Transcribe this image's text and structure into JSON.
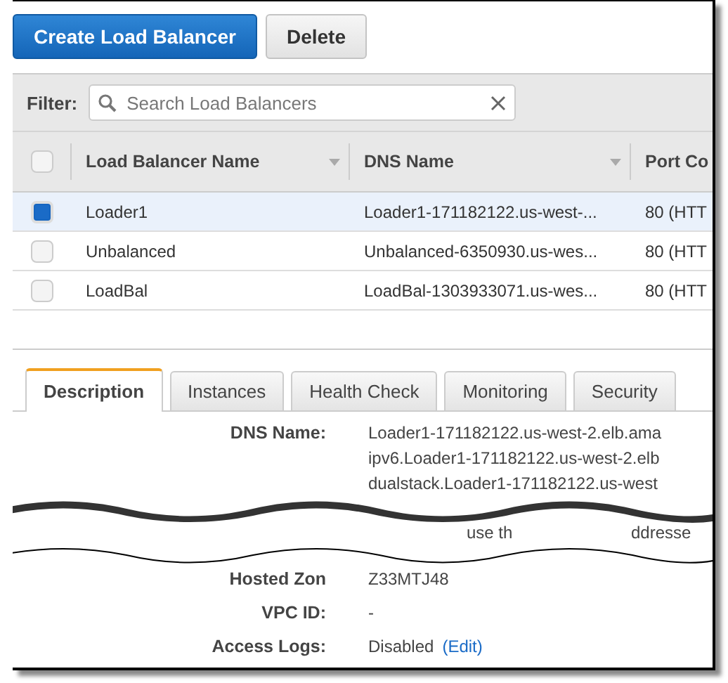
{
  "toolbar": {
    "buttons": [
      {
        "label": "Create Load Balancer",
        "kind": "primary"
      },
      {
        "label": "Delete",
        "kind": "secondary"
      }
    ]
  },
  "filter": {
    "label": "Filter:",
    "placeholder": "Search Load Balancers"
  },
  "table": {
    "select_all": {
      "checked": false
    },
    "columns": [
      "Load Balancer Name",
      "DNS Name",
      "Port Co"
    ],
    "rows": [
      {
        "selected": true,
        "cells": [
          "Loader1",
          "Loader1-171182122.us-west-...",
          "80 (HTT"
        ]
      },
      {
        "selected": false,
        "cells": [
          "Unbalanced",
          "Unbalanced-6350930.us-wes...",
          "80 (HTT"
        ]
      },
      {
        "selected": false,
        "cells": [
          "LoadBal",
          "LoadBal-1303933071.us-wes...",
          "80 (HTT"
        ]
      }
    ]
  },
  "tabs": [
    {
      "label": "Description",
      "selected": true
    },
    {
      "label": "Instances",
      "selected": false
    },
    {
      "label": "Health Check",
      "selected": false
    },
    {
      "label": "Monitoring",
      "selected": false
    },
    {
      "label": "Security",
      "selected": false
    }
  ],
  "details_top": [
    {
      "label": "DNS Name:",
      "values": [
        "Loader1-171182122.us-west-2.elb.ama",
        "ipv6.Loader1-171182122.us-west-2.elb",
        "dualstack.Loader1-171182122.us-west"
      ]
    }
  ],
  "torn_fragments": [
    "use th",
    "ddresse"
  ],
  "details_bottom": [
    {
      "label": "Hosted Zon",
      "value": "Z33MTJ48"
    },
    {
      "label": "VPC ID:",
      "value": "-"
    },
    {
      "label": "Access Logs:",
      "value": "Disabled",
      "link": "(Edit)"
    }
  ]
}
